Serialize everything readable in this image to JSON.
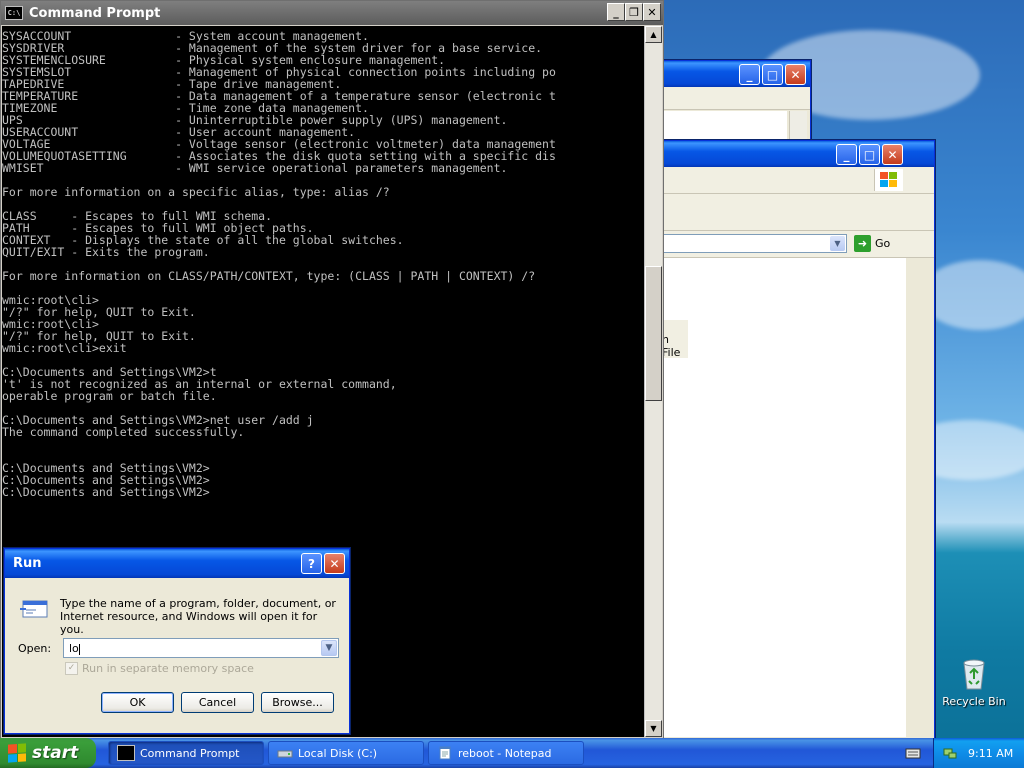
{
  "cmd": {
    "title": "Command Prompt",
    "lines": [
      "SYSACCOUNT               - System account management.",
      "SYSDRIVER                - Management of the system driver for a base service.",
      "SYSTEMENCLOSURE          - Physical system enclosure management.",
      "SYSTEMSLOT               - Management of physical connection points including po",
      "TAPEDRIVE                - Tape drive management.",
      "TEMPERATURE              - Data management of a temperature sensor (electronic t",
      "TIMEZONE                 - Time zone data management.",
      "UPS                      - Uninterruptible power supply (UPS) management.",
      "USERACCOUNT              - User account management.",
      "VOLTAGE                  - Voltage sensor (electronic voltmeter) data management",
      "VOLUMEQUOTASETTING       - Associates the disk quota setting with a specific dis",
      "WMISET                   - WMI service operational parameters management.",
      "",
      "For more information on a specific alias, type: alias /?",
      "",
      "CLASS     - Escapes to full WMI schema.",
      "PATH      - Escapes to full WMI object paths.",
      "CONTEXT   - Displays the state of all the global switches.",
      "QUIT/EXIT - Exits the program.",
      "",
      "For more information on CLASS/PATH/CONTEXT, type: (CLASS | PATH | CONTEXT) /?",
      "",
      "wmic:root\\cli>",
      "\"/?\" for help, QUIT to Exit.",
      "wmic:root\\cli>",
      "\"/?\" for help, QUIT to Exit.",
      "wmic:root\\cli>exit",
      "",
      "C:\\Documents and Settings\\VM2>t",
      "'t' is not recognized as an internal or external command,",
      "operable program or batch file.",
      "",
      "C:\\Documents and Settings\\VM2>net user /add j",
      "The command completed successfully.",
      "",
      "",
      "C:\\Documents and Settings\\VM2>",
      "C:\\Documents and Settings\\VM2>",
      "C:\\Documents and Settings\\VM2>"
    ]
  },
  "explorer": {
    "go_label": "Go",
    "partial_file_label": "n File"
  },
  "run": {
    "title": "Run",
    "help_btn": "?",
    "description": "Type the name of a program, folder, document, or Internet resource, and Windows will open it for you.",
    "open_label": "Open:",
    "open_value": "lo",
    "checkbox_label": "Run in separate memory space",
    "ok": "OK",
    "cancel": "Cancel",
    "browse": "Browse..."
  },
  "desktop": {
    "recycle_bin": "Recycle Bin"
  },
  "taskbar": {
    "start": "start",
    "tasks": [
      "Command Prompt",
      "Local Disk (C:)",
      "reboot - Notepad"
    ],
    "clock": "9:11 AM"
  }
}
